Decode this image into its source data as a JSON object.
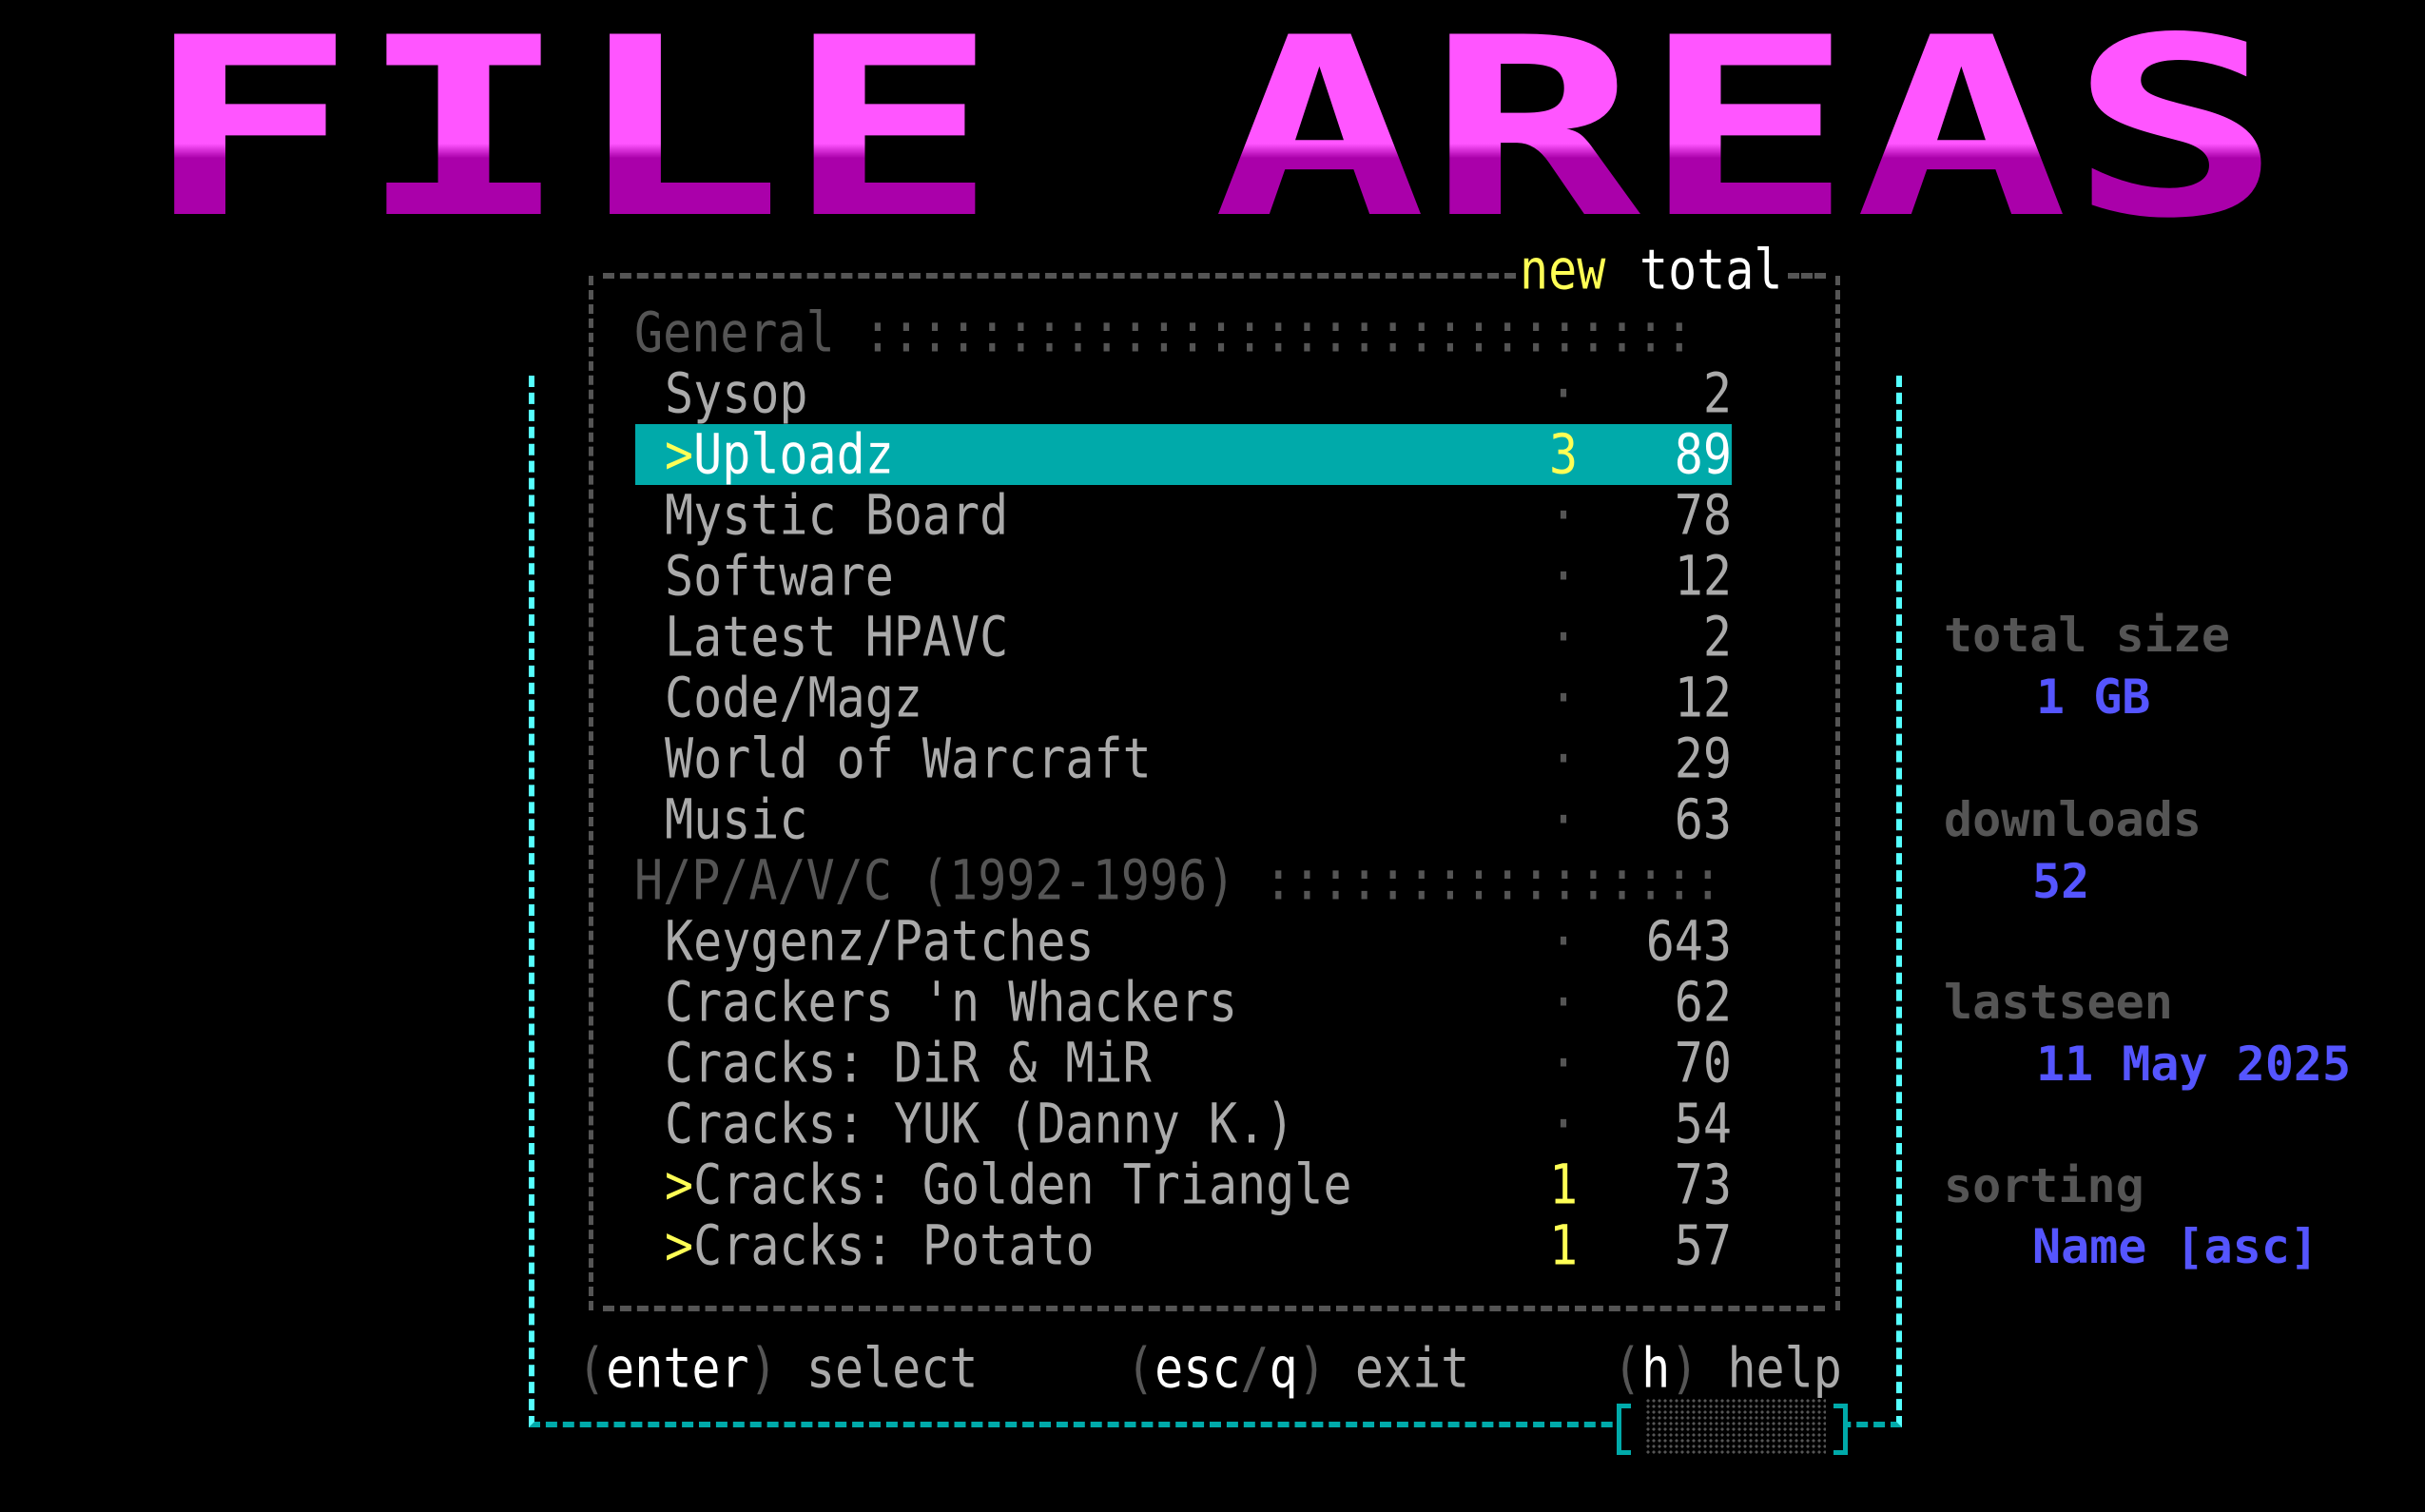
{
  "logo": {
    "text": "FILE AREAS",
    "colors": {
      "light": "#ff55ff",
      "dark": "#aa00aa",
      "gray": "#555555"
    }
  },
  "header": {
    "new_label": "new",
    "total_label": "total"
  },
  "groups": [
    {
      "title": "General",
      "dots": ":::::::::::::::::::::::::::::",
      "items": [
        {
          "marker": "",
          "name": "Sysop",
          "new": "·",
          "total": "2",
          "selected": false
        },
        {
          "marker": ">",
          "name": "Uploadz",
          "new": "3",
          "total": "89",
          "selected": true
        },
        {
          "marker": "",
          "name": "Mystic Board",
          "new": "·",
          "total": "78",
          "selected": false
        },
        {
          "marker": "",
          "name": "Software",
          "new": "·",
          "total": "12",
          "selected": false
        },
        {
          "marker": "",
          "name": "Latest HPAVC",
          "new": "·",
          "total": "2",
          "selected": false
        },
        {
          "marker": "",
          "name": "Code/Magz",
          "new": "·",
          "total": "12",
          "selected": false
        },
        {
          "marker": "",
          "name": "World of Warcraft",
          "new": "·",
          "total": "29",
          "selected": false
        },
        {
          "marker": "",
          "name": "Music",
          "new": "·",
          "total": "63",
          "selected": false
        }
      ]
    },
    {
      "title": "H/P/A/V/C (1992-1996)",
      "dots": "::::::::::::::::",
      "items": [
        {
          "marker": "",
          "name": "Keygenz/Patches",
          "new": "·",
          "total": "643",
          "selected": false
        },
        {
          "marker": "",
          "name": "Crackers 'n Whackers",
          "new": "·",
          "total": "62",
          "selected": false
        },
        {
          "marker": "",
          "name": "Cracks: DiR & MiR",
          "new": "·",
          "total": "70",
          "selected": false
        },
        {
          "marker": "",
          "name": "Cracks: YUK (Danny K.)",
          "new": "·",
          "total": "54",
          "selected": false
        },
        {
          "marker": ">",
          "name": "Cracks: Golden Triangle",
          "new": "1",
          "total": "73",
          "selected": false
        },
        {
          "marker": ">",
          "name": "Cracks: Potato",
          "new": "1",
          "total": "57",
          "selected": false
        }
      ]
    }
  ],
  "stats": {
    "total_size": {
      "label": "total size",
      "value": "1 GB"
    },
    "downloads": {
      "label": "downloads",
      "value": "52"
    },
    "lastseen": {
      "label": "lastseen",
      "value": "11 May 2025"
    },
    "sorting": {
      "label": "sorting",
      "value": "Name [asc]"
    }
  },
  "footer": {
    "select": {
      "key": "enter",
      "action": "select"
    },
    "exit": {
      "key1": "esc",
      "sep": "/",
      "key2": "q",
      "action": "exit"
    },
    "help": {
      "key": "h",
      "action": "help"
    }
  },
  "colors": {
    "accent": "#00aaaa",
    "bright_cyan": "#55ffff",
    "new_count": "#ffff55",
    "stat_value": "#5555ff"
  }
}
